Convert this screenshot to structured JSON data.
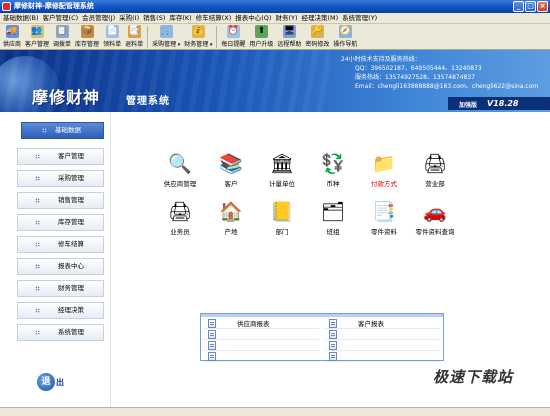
{
  "window": {
    "title": "摩修财神-摩修配管理系统",
    "minimize": "_",
    "maximize": "□",
    "close": "×"
  },
  "menu": [
    "基础数据(B)",
    "客户管理(C)",
    "会员管理(J)",
    "采购(I)",
    "销售(S)",
    "库存(K)",
    "修车结算(X)",
    "报表中心(Q)",
    "财务(Y)",
    "经理决策(M)",
    "系统管理(Y)"
  ],
  "toolbar": [
    {
      "label": "供应商",
      "icon": "truck-icon",
      "glyph": "🚚",
      "color": "#6b8fd4",
      "dropdown": false
    },
    {
      "label": "客户管理",
      "icon": "customer-icon",
      "glyph": "👥",
      "color": "#d9c06a",
      "dropdown": false
    },
    {
      "label": "调拨单",
      "icon": "transfer-icon",
      "glyph": "📋",
      "color": "#7fa8de",
      "dropdown": false
    },
    {
      "label": "库存管理",
      "icon": "inventory-icon",
      "glyph": "📦",
      "color": "#c48c44",
      "dropdown": false
    },
    {
      "label": "领料单",
      "icon": "requisition-icon",
      "glyph": "📄",
      "color": "#9fbfe8",
      "dropdown": false
    },
    {
      "label": "退料单",
      "icon": "return-icon",
      "glyph": "📑",
      "color": "#e29b48",
      "dropdown": false
    },
    {
      "label": "采购管理",
      "icon": "purchase-icon",
      "glyph": "🛒",
      "color": "#90b8e6",
      "dropdown": true
    },
    {
      "label": "财务管理",
      "icon": "finance-icon",
      "glyph": "💰",
      "color": "#e0b64a",
      "dropdown": true
    },
    {
      "label": "每日提醒",
      "icon": "reminder-icon",
      "glyph": "⏰",
      "color": "#9cc4ea",
      "dropdown": false
    },
    {
      "label": "用户升级",
      "icon": "upgrade-icon",
      "glyph": "⬆",
      "color": "#62a35b",
      "dropdown": false
    },
    {
      "label": "远程帮助",
      "icon": "remote-help-icon",
      "glyph": "🖥",
      "color": "#7ea0d8",
      "dropdown": false
    },
    {
      "label": "密码修改",
      "icon": "password-icon",
      "glyph": "🔑",
      "color": "#d6b24d",
      "dropdown": false
    },
    {
      "label": "操作导航",
      "icon": "navigation-icon",
      "glyph": "🧭",
      "color": "#8ab0e0",
      "dropdown": false
    }
  ],
  "banner": {
    "brand": "摩修财神",
    "subtitle": "管理系统",
    "contact": [
      "24小时技术支持及服务热线：",
      "QQ：396502187、649505444、13240873",
      "服务热线：13574927528、13574874837",
      "Email：chengli163888888@163.com、chengli622@sina.com"
    ],
    "edition": "加强版",
    "version": "V18.28"
  },
  "sidebar": {
    "items": [
      "基础数据",
      "客户管理",
      "采购管理",
      "销售管理",
      "库存管理",
      "修车结算",
      "报表中心",
      "财务管理",
      "经理决策",
      "系统管理"
    ],
    "active_index": 0,
    "exit_label": "出",
    "exit_icon_text": "退"
  },
  "grid": [
    {
      "label": "供应商管理",
      "icon": "supplier-search-icon",
      "glyph": "🔍",
      "highlight": false
    },
    {
      "label": "客户",
      "icon": "customer-books-icon",
      "glyph": "📚",
      "highlight": false
    },
    {
      "label": "计量单位",
      "icon": "unit-measure-icon",
      "glyph": "🏛",
      "highlight": false
    },
    {
      "label": "币种",
      "icon": "currency-icon",
      "glyph": "💱",
      "highlight": false
    },
    {
      "label": "付款方式",
      "icon": "payment-method-icon",
      "glyph": "📁",
      "highlight": true
    },
    {
      "label": "营业部",
      "icon": "business-dept-icon",
      "glyph": "🖨",
      "highlight": false
    },
    {
      "label": "业务员",
      "icon": "salesman-icon",
      "glyph": "🖨",
      "highlight": false
    },
    {
      "label": "产地",
      "icon": "origin-house-icon",
      "glyph": "🏠",
      "highlight": false
    },
    {
      "label": "部门",
      "icon": "department-icon",
      "glyph": "📒",
      "highlight": false
    },
    {
      "label": "班组",
      "icon": "team-icon",
      "glyph": "🗂",
      "highlight": false
    },
    {
      "label": "零件资料",
      "icon": "parts-data-icon",
      "glyph": "📑",
      "highlight": false
    },
    {
      "label": "零件资料查询",
      "icon": "parts-query-icon",
      "glyph": "🚗",
      "highlight": false
    }
  ],
  "reports": {
    "left": [
      "供应商报表",
      "",
      "",
      ""
    ],
    "right": [
      "客户报表",
      "",
      "",
      ""
    ]
  },
  "watermark": "极速下载站"
}
